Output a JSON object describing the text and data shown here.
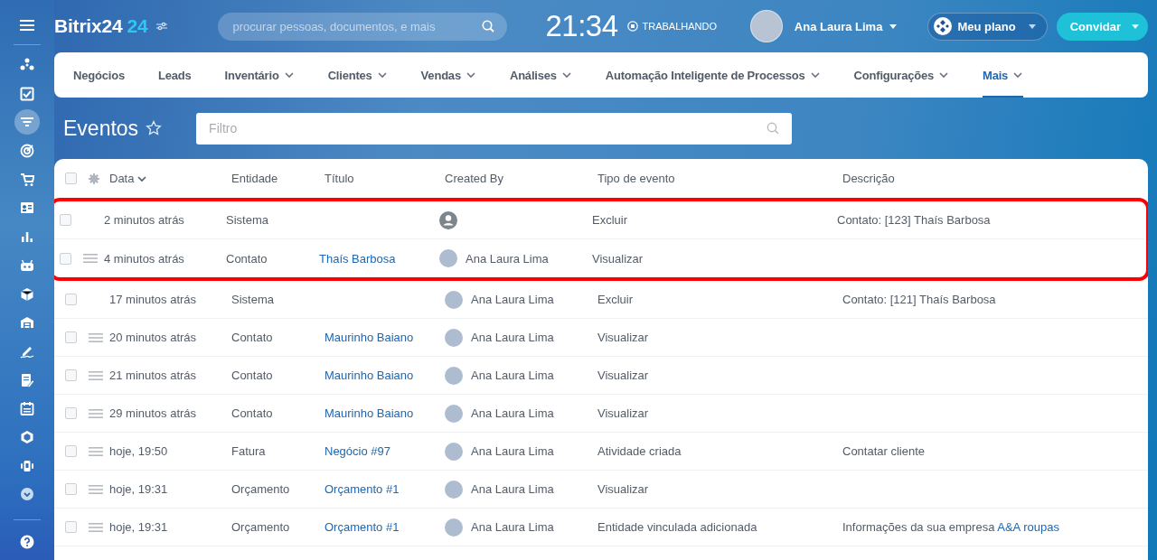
{
  "header": {
    "logo": "Bitrix24",
    "logo_suffix": "24",
    "search": {
      "placeholder": "procurar pessoas, documentos, e mais"
    },
    "clock": "21:34",
    "work_status": "TRABALHANDO",
    "user": {
      "name": "Ana Laura Lima"
    },
    "plan_button": "Meu plano",
    "invite_button": "Convidar"
  },
  "nav": {
    "items": [
      {
        "label": "Negócios",
        "dropdown": false,
        "selected": false
      },
      {
        "label": "Leads",
        "dropdown": false,
        "selected": false
      },
      {
        "label": "Inventário",
        "dropdown": true,
        "selected": false
      },
      {
        "label": "Clientes",
        "dropdown": true,
        "selected": false
      },
      {
        "label": "Vendas",
        "dropdown": true,
        "selected": false
      },
      {
        "label": "Análises",
        "dropdown": true,
        "selected": false
      },
      {
        "label": "Automação Inteligente de Processos",
        "dropdown": true,
        "selected": false
      },
      {
        "label": "Configurações",
        "dropdown": true,
        "selected": false
      },
      {
        "label": "Mais",
        "dropdown": true,
        "selected": true
      }
    ]
  },
  "page": {
    "title": "Eventos",
    "filter": {
      "placeholder": "Filtro"
    }
  },
  "table": {
    "select_all_checked": false,
    "columns": [
      "Data",
      "Entidade",
      "Título",
      "Created By",
      "Tipo de evento",
      "Descrição"
    ],
    "rows": [
      {
        "checked": false,
        "highlighted": true,
        "drag_handle": false,
        "date": "2 minutos atrás",
        "entity": "Sistema",
        "created_by": {
          "kind": "default"
        },
        "event_type": "Excluir",
        "description": "Contato: [123] Thaís Barbosa"
      },
      {
        "checked": false,
        "highlighted": true,
        "drag_handle": true,
        "date": "4 minutos atrás",
        "entity": "Contato",
        "title": "Thaís Barbosa",
        "created_by": {
          "kind": "photo",
          "name": "Ana Laura Lima"
        },
        "event_type": "Visualizar"
      },
      {
        "checked": false,
        "highlighted": false,
        "drag_handle": false,
        "date": "17 minutos atrás",
        "entity": "Sistema",
        "created_by": {
          "kind": "photo",
          "name": "Ana Laura Lima"
        },
        "event_type": "Excluir",
        "description": "Contato: [121] Thaís Barbosa"
      },
      {
        "checked": false,
        "highlighted": false,
        "drag_handle": true,
        "date": "20 minutos atrás",
        "entity": "Contato",
        "title": "Maurinho Baiano",
        "created_by": {
          "kind": "photo",
          "name": "Ana Laura Lima"
        },
        "event_type": "Visualizar"
      },
      {
        "checked": false,
        "highlighted": false,
        "drag_handle": true,
        "date": "21 minutos atrás",
        "entity": "Contato",
        "title": "Maurinho Baiano",
        "created_by": {
          "kind": "photo",
          "name": "Ana Laura Lima"
        },
        "event_type": "Visualizar"
      },
      {
        "checked": false,
        "highlighted": false,
        "drag_handle": true,
        "date": "29 minutos atrás",
        "entity": "Contato",
        "title": "Maurinho Baiano",
        "created_by": {
          "kind": "photo",
          "name": "Ana Laura Lima"
        },
        "event_type": "Visualizar"
      },
      {
        "checked": false,
        "highlighted": false,
        "drag_handle": true,
        "date": "hoje, 19:50",
        "entity": "Fatura",
        "title": "Negócio #97",
        "created_by": {
          "kind": "photo",
          "name": "Ana Laura Lima"
        },
        "event_type": "Atividade criada",
        "description": "Contatar cliente"
      },
      {
        "checked": false,
        "highlighted": false,
        "drag_handle": true,
        "date": "hoje, 19:31",
        "entity": "Orçamento",
        "title": "Orçamento #1",
        "created_by": {
          "kind": "photo",
          "name": "Ana Laura Lima"
        },
        "event_type": "Visualizar"
      },
      {
        "checked": false,
        "highlighted": false,
        "drag_handle": true,
        "date": "hoje, 19:31",
        "entity": "Orçamento",
        "title": "Orçamento #1",
        "created_by": {
          "kind": "photo",
          "name": "Ana Laura Lima"
        },
        "event_type": "Entidade vinculada adicionada",
        "description": "Informações da sua empresa",
        "description_link": "A&A roupas"
      }
    ]
  }
}
